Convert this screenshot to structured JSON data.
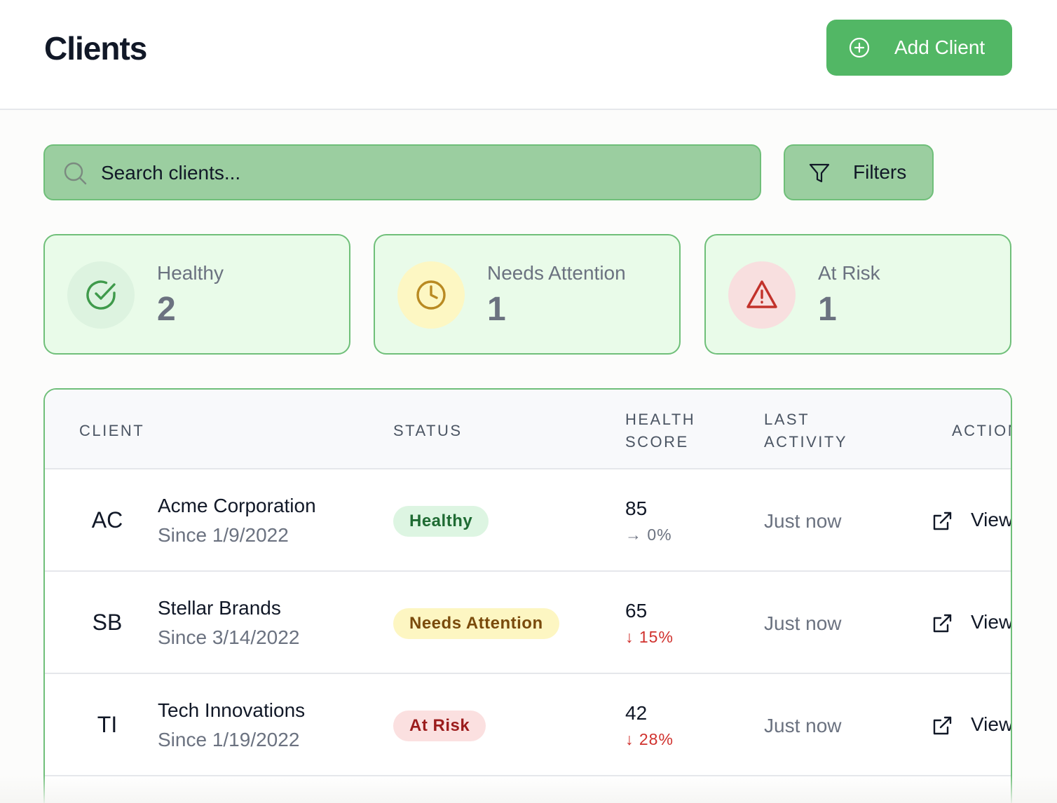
{
  "header": {
    "title": "Clients",
    "add_button_label": "Add Client",
    "add_button_icon": "plus-circle-icon"
  },
  "search": {
    "placeholder": "Search clients...",
    "value": ""
  },
  "filters": {
    "label": "Filters",
    "icon": "filter-icon"
  },
  "summary": [
    {
      "title": "Healthy",
      "count": "2",
      "icon": "check-circle-icon",
      "color": "#3f9a4b",
      "bg": "#ddf3e0"
    },
    {
      "title": "Needs Attention",
      "count": "1",
      "icon": "clock-icon",
      "color": "#b98a22",
      "bg": "#fdf7c3"
    },
    {
      "title": "At Risk",
      "count": "1",
      "icon": "warning-triangle-icon",
      "color": "#c2322b",
      "bg": "#f8dfdf"
    }
  ],
  "table": {
    "columns": {
      "client": "CLIENT",
      "status": "STATUS",
      "health_score_1": "HEALTH",
      "health_score_2": "SCORE",
      "last_activity_1": "LAST",
      "last_activity_2": "ACTIVITY",
      "actions": "ACTIONS"
    },
    "rows": [
      {
        "initials": "AC",
        "name": "Acme Corporation",
        "since": "Since 1/9/2022",
        "status": "Healthy",
        "status_color": "#1f6b33",
        "status_bg": "#ddf5e2",
        "score": "85",
        "trend": "→ 0%",
        "trend_color": "#6b7280",
        "last_activity": "Just now",
        "action": "View"
      },
      {
        "initials": "SB",
        "name": "Stellar Brands",
        "since": "Since 3/14/2022",
        "status": "Needs Attention",
        "status_color": "#7a4b0c",
        "status_bg": "#fdf6c2",
        "score": "65",
        "trend": "↓ 15%",
        "trend_color": "#d0312d",
        "last_activity": "Just now",
        "action": "View"
      },
      {
        "initials": "TI",
        "name": "Tech Innovations",
        "since": "Since 1/19/2022",
        "status": "At Risk",
        "status_color": "#9b1c1c",
        "status_bg": "#fbe0e0",
        "score": "42",
        "trend": "↓ 28%",
        "trend_color": "#d0312d",
        "last_activity": "Just now",
        "action": "View"
      }
    ]
  }
}
